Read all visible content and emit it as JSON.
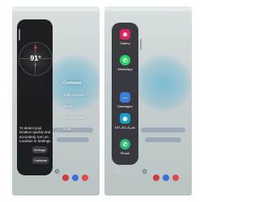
{
  "left_phone": {
    "compass": {
      "degree": "91°",
      "direction": "E"
    },
    "location_message": "To detect your location quickly and accurately, turn on Location in Settings.",
    "settings_button": "Settings",
    "calibrate_button": "Calibrate",
    "tools": [
      "Compass",
      "Tally counter",
      "Torch",
      "Surface level",
      "Ruler"
    ]
  },
  "right_phone": {
    "apps": [
      {
        "label": "Gallery",
        "icon": "gallery-icon",
        "color": "#e0245e",
        "glyph": "❀"
      },
      {
        "label": "WhatsApp",
        "icon": "whatsapp-icon",
        "color": "#25d366",
        "glyph": "✆"
      },
      {
        "label": "Messages",
        "icon": "messages-icon",
        "color": "#3b7bd9",
        "glyph": "…"
      },
      {
        "label": "همراه بانک اکتا",
        "icon": "bank-app-icon",
        "color": "#1aa0c8",
        "glyph": "◉"
      },
      {
        "label": "Phone",
        "icon": "phone-icon",
        "color": "#2bb673",
        "glyph": "✆"
      }
    ]
  },
  "colors": {
    "panel_dark": "#121216",
    "accent_red": "#e04040"
  }
}
